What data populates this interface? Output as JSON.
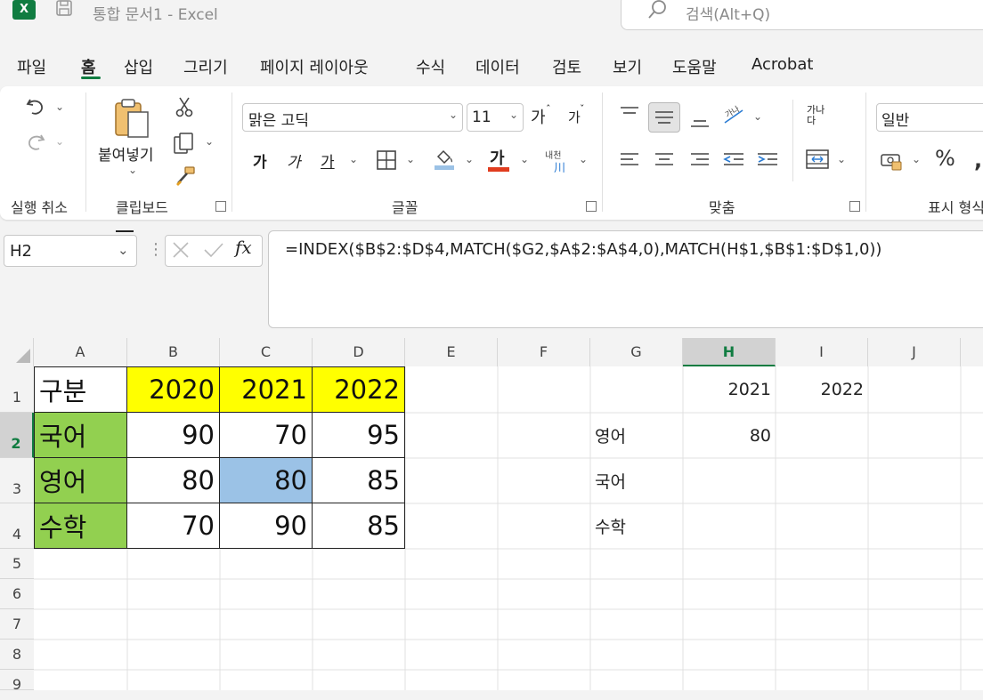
{
  "titlebar": {
    "app_letter": "X",
    "doc_title": "통합 문서1  -  Excel",
    "search_placeholder": "검색(Alt+Q)"
  },
  "tabs": [
    "파일",
    "홈",
    "삽입",
    "그리기",
    "페이지 레이아웃",
    "수식",
    "데이터",
    "검토",
    "보기",
    "도움말",
    "Acrobat"
  ],
  "active_tab": "홈",
  "ribbon": {
    "undo_group_label": "실행 취소",
    "clipboard": {
      "paste_label": "붙여넣기",
      "group_label": "클립보드"
    },
    "font": {
      "font_name": "맑은 고딕",
      "font_size": "11",
      "grow_label": "가",
      "shrink_label": "가",
      "bold_label": "가",
      "italic_label": "가",
      "underline_label": "가",
      "font_color_label": "가",
      "phonetic_label": "내천",
      "group_label": "글꼴"
    },
    "alignment": {
      "group_label": "맞춤",
      "wrap_label": "가나다"
    },
    "number": {
      "format": "일반",
      "percent_label": "%",
      "group_label": "표시 형식"
    }
  },
  "formula_bar": {
    "name_box": "H2",
    "fx_label": "fx",
    "formula": "=INDEX($B$2:$D$4,MATCH($G2,$A$2:$A$4,0),MATCH(H$1,$B$1:$D$1,0))"
  },
  "columns": [
    "A",
    "B",
    "C",
    "D",
    "E",
    "F",
    "G",
    "H",
    "I",
    "J"
  ],
  "rows": [
    "1",
    "2",
    "3",
    "4",
    "5",
    "6",
    "7",
    "8",
    "9"
  ],
  "table": {
    "header": [
      "구분",
      "2020",
      "2021",
      "2022"
    ],
    "rows": [
      [
        "국어",
        "90",
        "70",
        "95"
      ],
      [
        "영어",
        "80",
        "80",
        "85"
      ],
      [
        "수학",
        "70",
        "90",
        "85"
      ]
    ]
  },
  "lookup": {
    "years": [
      "2021",
      "2022"
    ],
    "subjects": [
      "영어",
      "국어",
      "수학"
    ],
    "h2_value": "80"
  },
  "colors": {
    "header_fill": "#ffff00",
    "subject_fill": "#92d050",
    "highlight_fill": "#9bc2e6",
    "excel_green": "#107c41"
  }
}
